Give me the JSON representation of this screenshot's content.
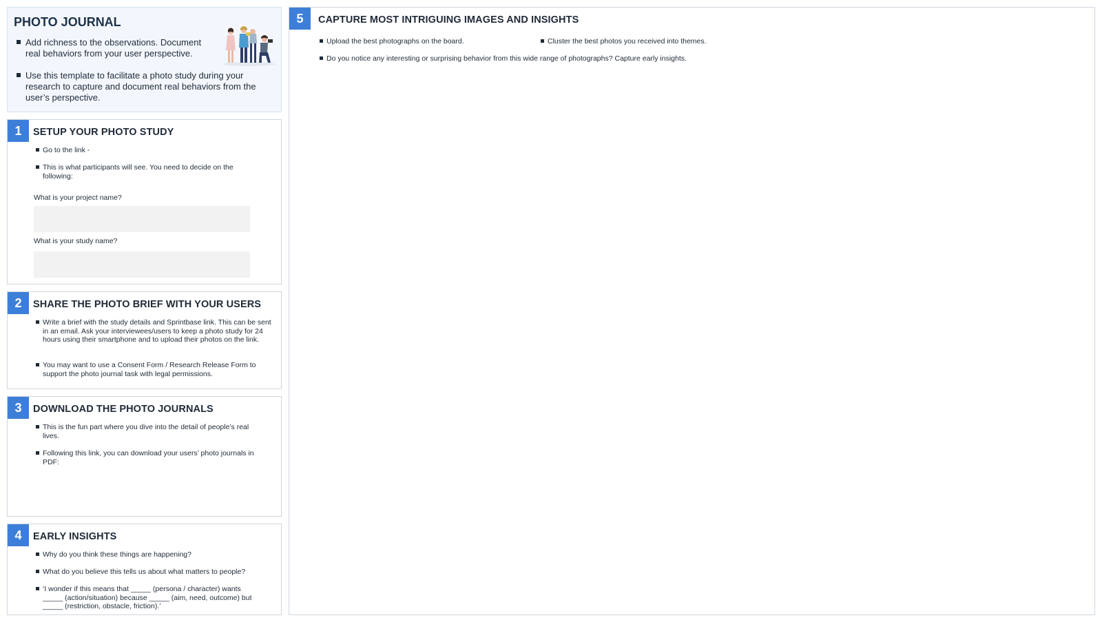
{
  "intro": {
    "title": "PHOTO JOURNAL",
    "bullets": [
      "Add richness to the observations. Document real behaviors from your user perspective.",
      "Use this template to facilitate a photo study during your research to capture and document real behaviors from the user’s perspective."
    ],
    "illustration_icon": "people-photographing-icon"
  },
  "step1": {
    "number": "1",
    "title": "SETUP YOUR PHOTO STUDY",
    "bullets": [
      "Go to the link -",
      "This is what participants will see. You need to decide on the following:"
    ],
    "project_label": "What is your project name?",
    "project_value": "",
    "study_label": "What is your study name?",
    "study_value": ""
  },
  "step2": {
    "number": "2",
    "title": "SHARE THE PHOTO BRIEF WITH YOUR USERS",
    "bullets": [
      "Write a brief with the study details and Sprintbase link. This can be sent in an email. Ask your interviewees/users to keep a photo study for 24 hours using their smartphone and to upload their photos on the link.",
      "You may want to use a Consent Form / Research Release Form to support the photo journal task with legal permissions."
    ]
  },
  "step3": {
    "number": "3",
    "title": "DOWNLOAD THE PHOTO JOURNALS",
    "bullets": [
      "This is the fun part where you dive into the detail of people’s real lives.",
      "Following this link, you can download your users’ photo journals in PDF:"
    ]
  },
  "step4": {
    "number": "4",
    "title": "EARLY INSIGHTS",
    "bullets": [
      "Why do you think these things are happening?",
      "What do you believe this tells us about what matters to people?",
      "‘I wonder if this means that _____ (persona / character) wants _____ (action/situation) because _____ (aim, need, outcome) but _____ (restriction, obstacle, friction).’"
    ]
  },
  "step5": {
    "number": "5",
    "title": "CAPTURE MOST INTRIGUING IMAGES AND INSIGHTS",
    "bullets": [
      "Upload the best photographs on the board.",
      "Cluster the best photos you received into themes.",
      "Do you notice any interesting or surprising behavior from this wide range of photographs? Capture early insights."
    ]
  },
  "colors": {
    "accent": "#3d7fd8",
    "intro_bg": "#f3f7fd",
    "field_bg": "#f2f2f2",
    "border": "#cfd6de"
  }
}
